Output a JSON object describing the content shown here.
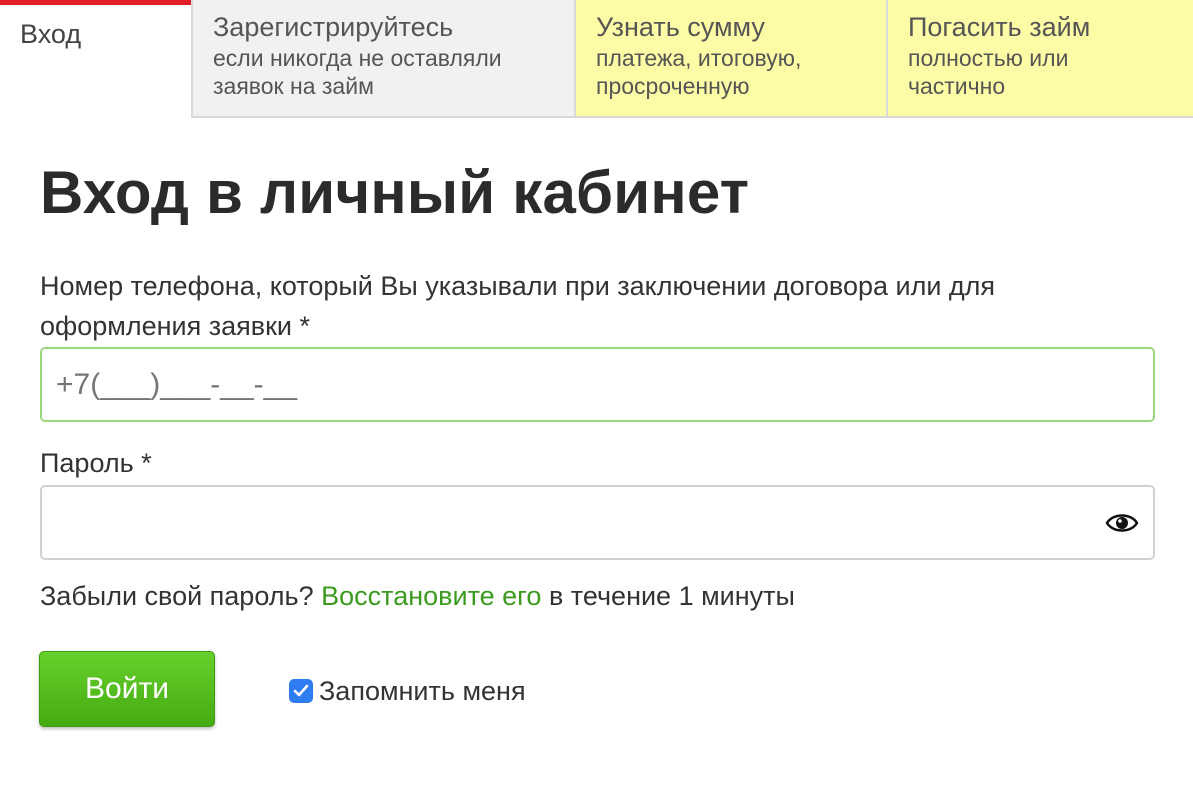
{
  "tabs": {
    "login": {
      "title": "Вход"
    },
    "register": {
      "title": "Зарегистрируйтесь",
      "sub1": "если никогда не оставляли",
      "sub2": "заявок на займ"
    },
    "sum": {
      "title": "Узнать сумму",
      "sub1": "платежа, итоговую,",
      "sub2": "просроченную"
    },
    "repay": {
      "title": "Погасить займ",
      "sub1": "полностью или",
      "sub2": "частично"
    }
  },
  "heading": "Вход в личный кабинет",
  "phone": {
    "label": "Номер телефона, который Вы указывали при заключении договора или для оформления заявки *",
    "placeholder": "+7(___)___-__-__"
  },
  "password": {
    "label": "Пароль *",
    "value": ""
  },
  "forgot": {
    "prefix": "Забыли свой пароль?",
    "link": "Восстановите его",
    "suffix": "в течение 1 минуты"
  },
  "login_button": "Войти",
  "remember": {
    "label": "Запомнить меня",
    "checked": true
  },
  "colors": {
    "active_tab_border": "#e21f26",
    "highlight_tab": "#fdfca6",
    "link": "#3b9b1e",
    "button": "#52be1a",
    "checkbox": "#2f7bf0"
  },
  "icons": {
    "password_toggle": "eye-icon",
    "checkbox": "checkmark-icon"
  }
}
